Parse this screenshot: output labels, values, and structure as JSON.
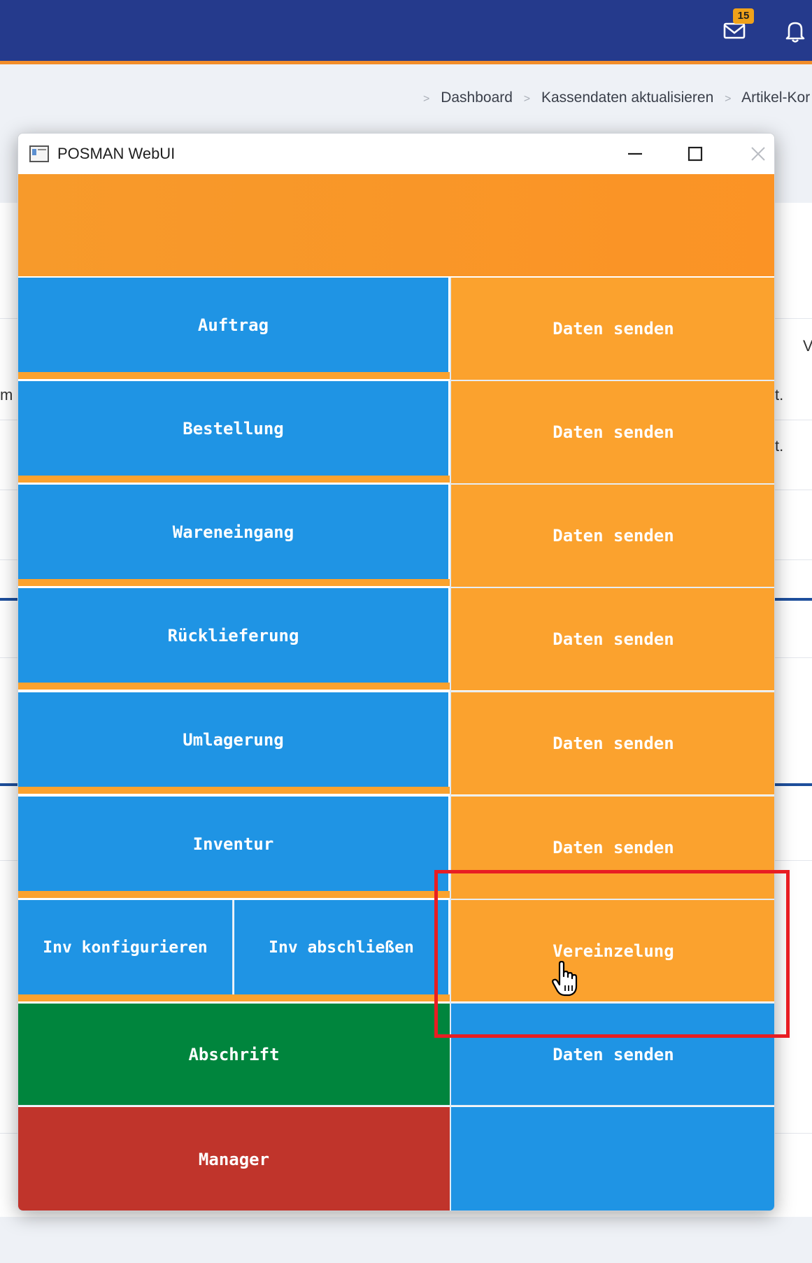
{
  "header": {
    "mail_badge": "15",
    "icons": [
      "mail-icon",
      "bell-icon"
    ]
  },
  "breadcrumb": {
    "items": [
      "Dashboard",
      "Kassendaten aktualisieren",
      "Artikel-Kor"
    ]
  },
  "background": {
    "fragments": [
      "m",
      "t.",
      "t.",
      "V"
    ]
  },
  "window": {
    "title": "POSMAN WebUI",
    "controls": [
      "minimize-icon",
      "maximize-icon",
      "close-icon"
    ]
  },
  "menu": {
    "rows": [
      {
        "left": "Auftrag",
        "right": "Daten senden"
      },
      {
        "left": "Bestellung",
        "right": "Daten senden"
      },
      {
        "left": "Wareneingang",
        "right": "Daten senden"
      },
      {
        "left": "Rücklieferung",
        "right": "Daten senden"
      },
      {
        "left": "Umlagerung",
        "right": "Daten senden"
      },
      {
        "left": "Inventur",
        "right": "Daten senden"
      },
      {
        "left_a": "Inv konfigurieren",
        "left_b": "Inv abschließen",
        "right": "Vereinzelung"
      },
      {
        "left": "Abschrift",
        "right": "Daten senden"
      },
      {
        "left": "Manager",
        "right": ""
      }
    ]
  },
  "colors": {
    "header": "#253a8c",
    "accent_orange": "#fba22e",
    "tile_blue": "#1f94e4",
    "tile_green": "#00853d",
    "tile_red": "#c0342b",
    "highlight": "#e81d23"
  }
}
